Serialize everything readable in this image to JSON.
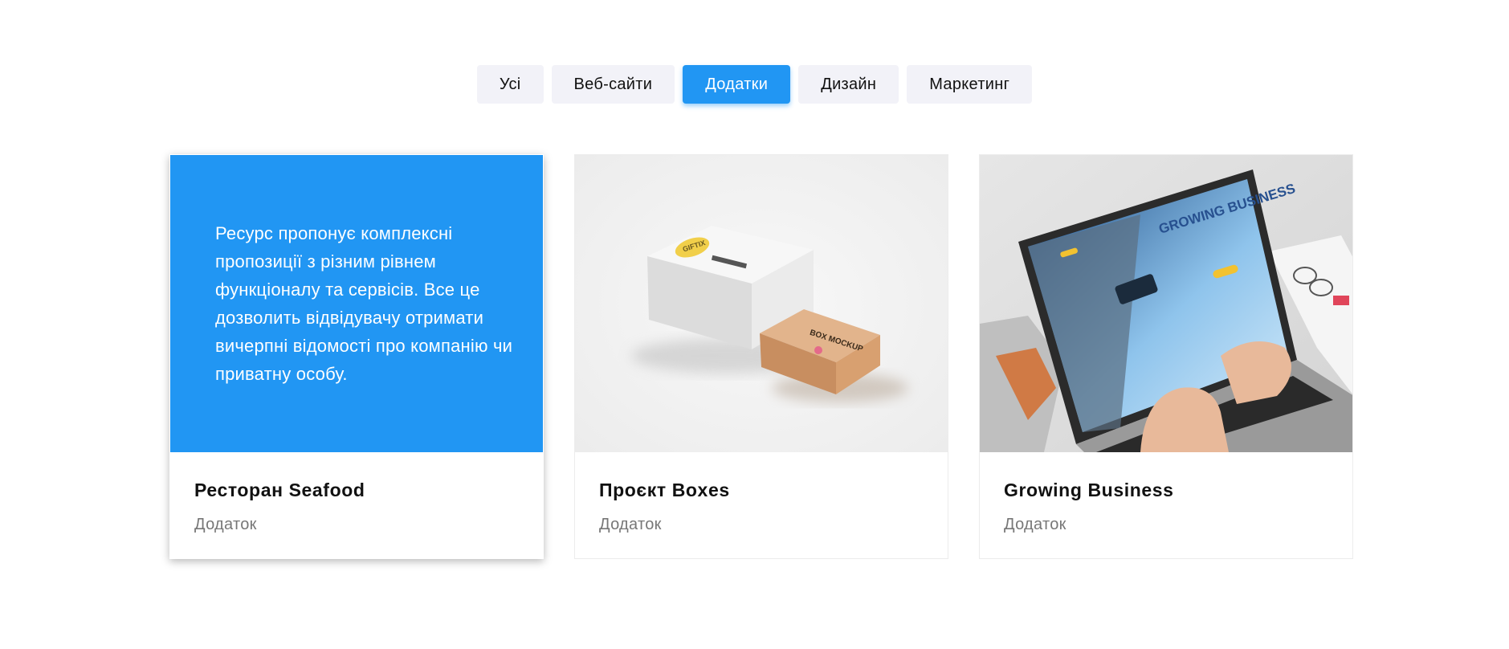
{
  "filters": {
    "items": [
      {
        "label": "Усі",
        "active": false
      },
      {
        "label": "Веб-сайти",
        "active": false
      },
      {
        "label": "Додатки",
        "active": true
      },
      {
        "label": "Дизайн",
        "active": false
      },
      {
        "label": "Маркетинг",
        "active": false
      }
    ]
  },
  "cards": [
    {
      "title": "Ресторан Seafood",
      "category": "Додаток",
      "description": "Ресурс пропонує комплексні пропозиції з різним рівнем функціоналу та сервісів. Все це дозволить відвідувачу отримати вичерпні відомості про компанію чи приватну особу."
    },
    {
      "title": "Проєкт Boxes",
      "category": "Додаток",
      "image": {
        "white_box_label": "GIFTIX",
        "kraft_box_label": "BOX MOCKUP"
      }
    },
    {
      "title": "Growing Business",
      "category": "Додаток",
      "image": {
        "screen_heading": "GROWING BUSINESS"
      }
    }
  ],
  "colors": {
    "accent": "#2196f3",
    "filter_bg": "#f2f2f8",
    "muted_text": "#777777"
  }
}
